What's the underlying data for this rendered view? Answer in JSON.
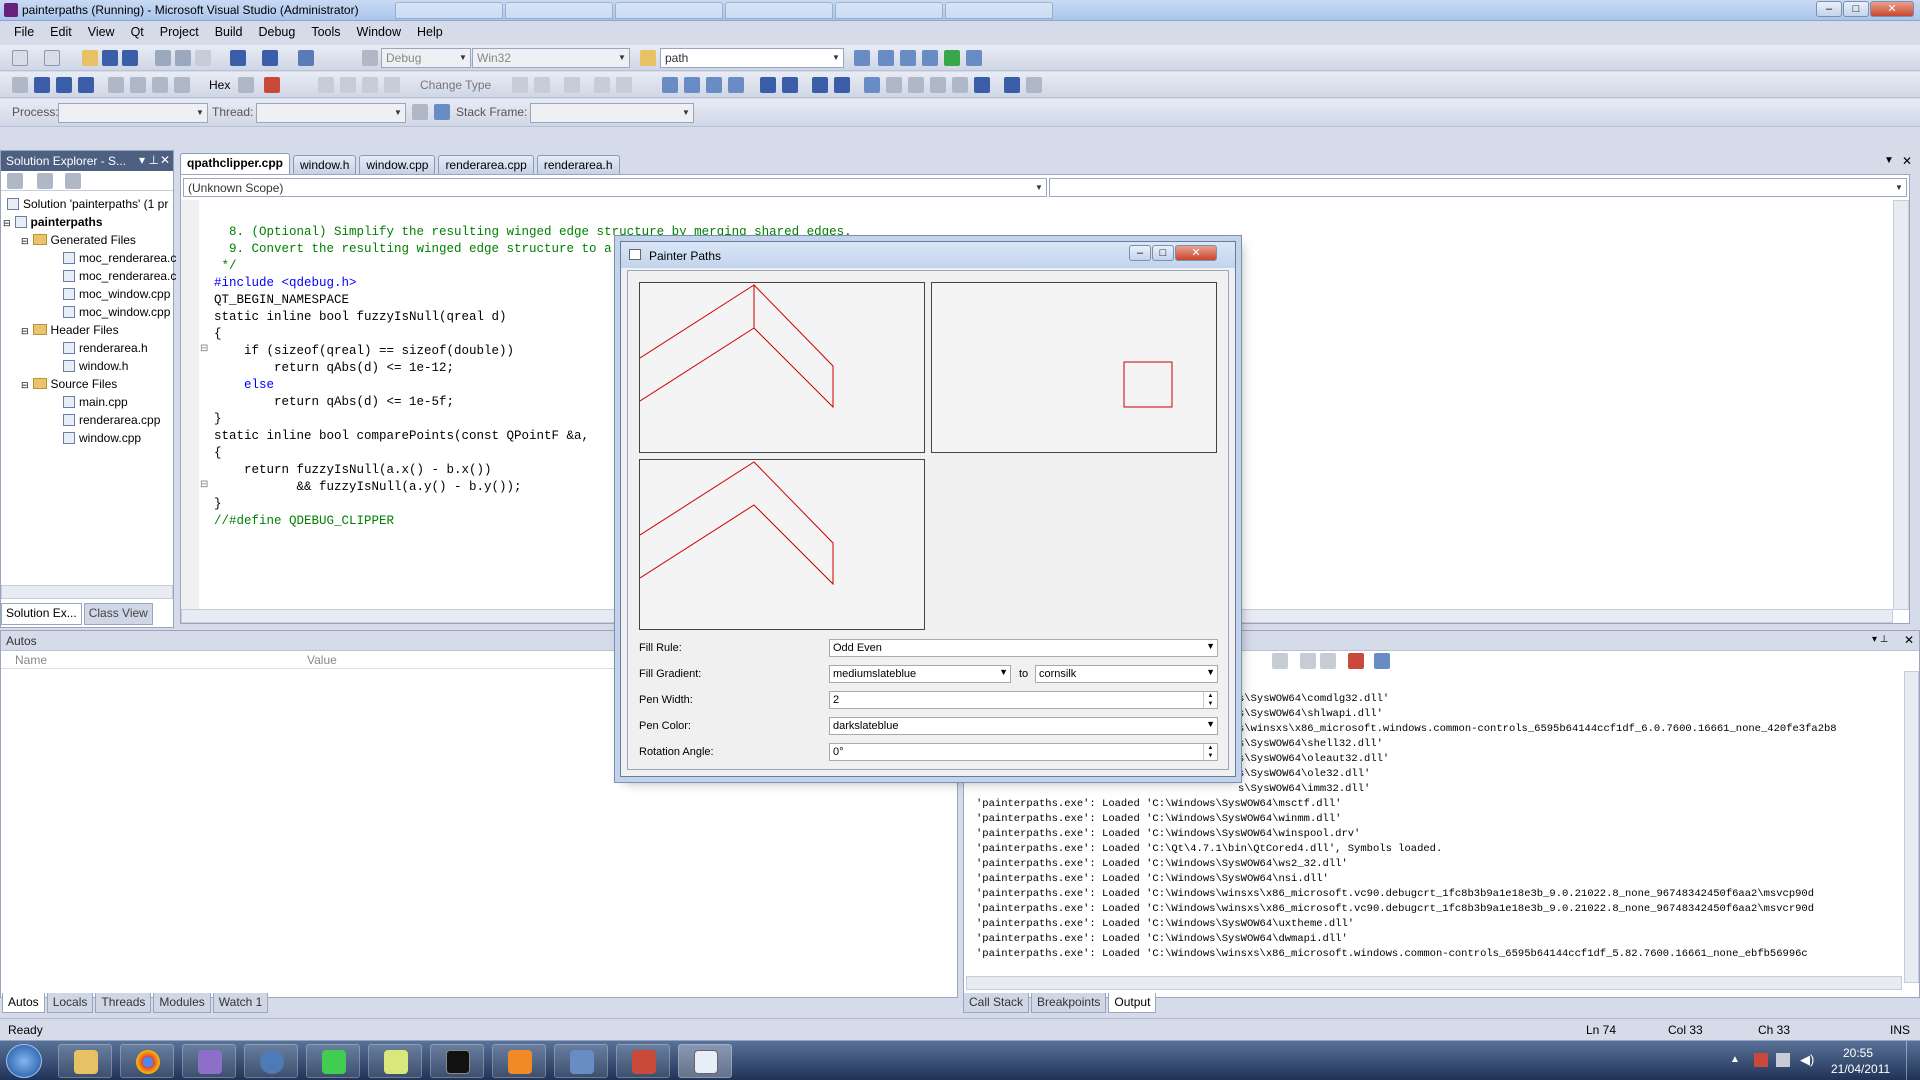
{
  "window": {
    "title": "painterpaths (Running) - Microsoft Visual Studio (Administrator)"
  },
  "bg_tabs": [
    "",
    "",
    "",
    "",
    "",
    ""
  ],
  "menu": [
    "File",
    "Edit",
    "View",
    "Qt",
    "Project",
    "Build",
    "Debug",
    "Tools",
    "Window",
    "Help"
  ],
  "toolbar": {
    "config": "Debug",
    "platform": "Win32",
    "find": "path",
    "hex": "Hex",
    "change_type": "Change Type"
  },
  "debug_bar": {
    "process_label": "Process:",
    "thread_label": "Thread:",
    "stack_label": "Stack Frame:"
  },
  "solution_explorer": {
    "title": "Solution Explorer - S...",
    "solution": "Solution 'painterpaths' (1 pr",
    "project": "painterpaths",
    "generated_folder": "Generated Files",
    "generated": [
      "moc_renderarea.c",
      "moc_renderarea.c",
      "moc_window.cpp",
      "moc_window.cpp"
    ],
    "header_folder": "Header Files",
    "headers": [
      "renderarea.h",
      "window.h"
    ],
    "source_folder": "Source Files",
    "sources": [
      "main.cpp",
      "renderarea.cpp",
      "window.cpp"
    ],
    "tab1": "Solution Ex...",
    "tab2": "Class View"
  },
  "editor": {
    "tabs": [
      "qpathclipper.cpp",
      "window.h",
      "window.cpp",
      "renderarea.cpp",
      "renderarea.h"
    ],
    "scope": "(Unknown Scope)",
    "code_lines": [
      "  8. (Optional) Simplify the resulting winged edge structure by merging shared edges.",
      "  9. Convert the resulting winged edge structure to a painter path.",
      " */",
      "",
      "#include <qdebug.h>",
      "",
      "QT_BEGIN_NAMESPACE",
      "",
      "static inline bool fuzzyIsNull(qreal d)",
      "{",
      "    if (sizeof(qreal) == sizeof(double))",
      "        return qAbs(d) <= 1e-12;",
      "    else",
      "        return qAbs(d) <= 1e-5f;",
      "}",
      "",
      "static inline bool comparePoints(const QPointF &a,",
      "{",
      "    return fuzzyIsNull(a.x() - b.x())",
      "           && fuzzyIsNull(a.y() - b.y());",
      "}",
      "",
      "//#define QDEBUG_CLIPPER"
    ]
  },
  "dialog": {
    "title": "Painter Paths",
    "fill_rule_label": "Fill Rule:",
    "fill_rule": "Odd Even",
    "fill_gradient_label": "Fill Gradient:",
    "gradient_from": "mediumslateblue",
    "gradient_to_label": "to",
    "gradient_to": "cornsilk",
    "pen_width_label": "Pen Width:",
    "pen_width": "2",
    "pen_color_label": "Pen Color:",
    "pen_color": "darkslateblue",
    "rotation_label": "Rotation Angle:",
    "rotation": "0°",
    "stroke_color": "#cc0000"
  },
  "autos": {
    "title": "Autos",
    "col_name": "Name",
    "col_value": "Value"
  },
  "output": {
    "lines": [
      "s\\SysWOW64\\comdlg32.dll'",
      "s\\SysWOW64\\shlwapi.dll'",
      "s\\winsxs\\x86_microsoft.windows.common-controls_6595b64144ccf1df_6.0.7600.16661_none_420fe3fa2b8",
      "s\\SysWOW64\\shell32.dll'",
      "s\\SysWOW64\\oleaut32.dll'",
      "s\\SysWOW64\\ole32.dll'",
      "s\\SysWOW64\\imm32.dll'",
      "'painterpaths.exe': Loaded 'C:\\Windows\\SysWOW64\\msctf.dll'",
      "'painterpaths.exe': Loaded 'C:\\Windows\\SysWOW64\\winmm.dll'",
      "'painterpaths.exe': Loaded 'C:\\Windows\\SysWOW64\\winspool.drv'",
      "'painterpaths.exe': Loaded 'C:\\Qt\\4.7.1\\bin\\QtCored4.dll', Symbols loaded.",
      "'painterpaths.exe': Loaded 'C:\\Windows\\SysWOW64\\ws2_32.dll'",
      "'painterpaths.exe': Loaded 'C:\\Windows\\SysWOW64\\nsi.dll'",
      "'painterpaths.exe': Loaded 'C:\\Windows\\winsxs\\x86_microsoft.vc90.debugcrt_1fc8b3b9a1e18e3b_9.0.21022.8_none_96748342450f6aa2\\msvcp90d",
      "'painterpaths.exe': Loaded 'C:\\Windows\\winsxs\\x86_microsoft.vc90.debugcrt_1fc8b3b9a1e18e3b_9.0.21022.8_none_96748342450f6aa2\\msvcr90d",
      "'painterpaths.exe': Loaded 'C:\\Windows\\SysWOW64\\uxtheme.dll'",
      "'painterpaths.exe': Loaded 'C:\\Windows\\SysWOW64\\dwmapi.dll'",
      "'painterpaths.exe': Loaded 'C:\\Windows\\winsxs\\x86_microsoft.windows.common-controls_6595b64144ccf1df_5.82.7600.16661_none_ebfb56996c"
    ]
  },
  "bottom_tabs_left": [
    "Autos",
    "Locals",
    "Threads",
    "Modules",
    "Watch 1"
  ],
  "bottom_tabs_right": [
    "Call Stack",
    "Breakpoints",
    "Output"
  ],
  "status": {
    "ready": "Ready",
    "ln": "Ln 74",
    "col": "Col 33",
    "ch": "Ch 33",
    "ins": "INS"
  },
  "taskbar": {
    "time": "20:55",
    "date": "21/04/2011"
  }
}
